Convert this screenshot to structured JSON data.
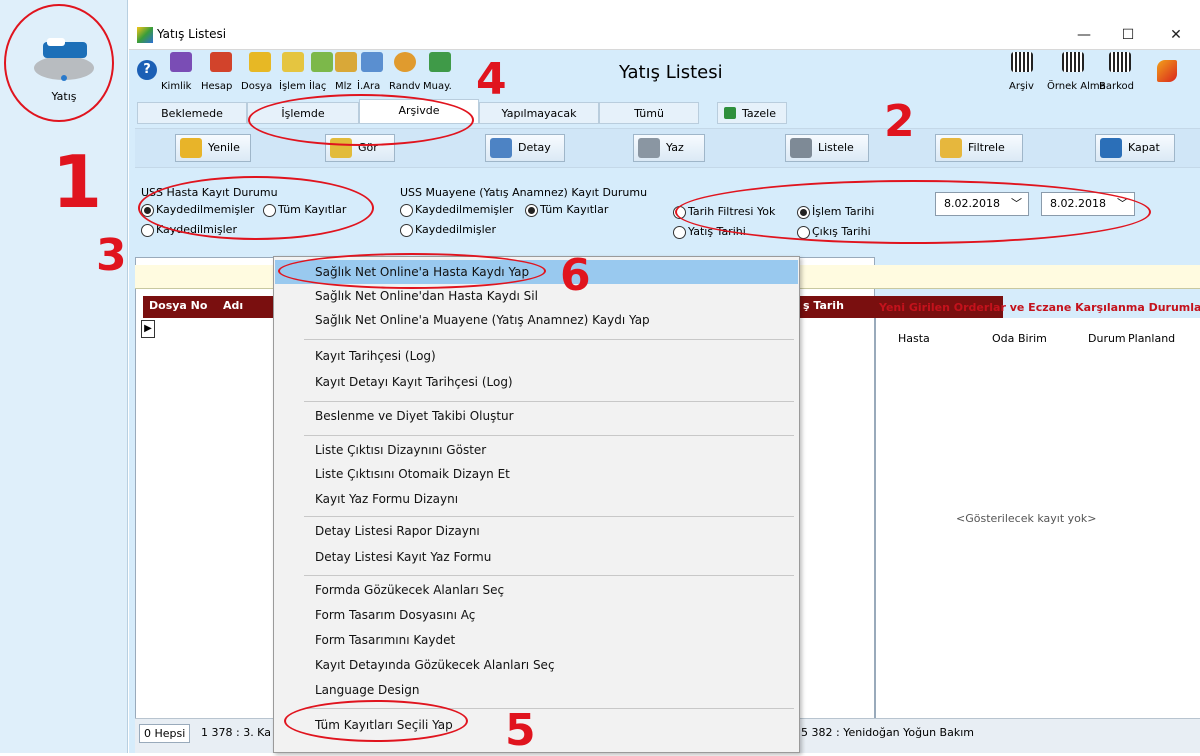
{
  "left_panel": {
    "tile_label": "Yatış"
  },
  "window": {
    "title": "Yatış Listesi",
    "min": "—",
    "max": "☐",
    "close": "✕"
  },
  "toolbar": {
    "title": "Yatış Listesi",
    "items": [
      "Kimlik",
      "Hesap",
      "Dosya",
      "İşlem",
      "İlaç",
      "Mlz",
      "İ.Ara",
      "Randv",
      "Muay."
    ],
    "right_items": [
      "Arşiv",
      "Örnek Alma",
      "Barkod"
    ]
  },
  "tabs": [
    "Beklemede",
    "İşlemde",
    "Arşivde",
    "Yapılmayacak",
    "Tümü",
    "Tazele"
  ],
  "buttons": [
    "Yenile",
    "Gör",
    "Detay",
    "Yaz",
    "Listele",
    "Filtrele",
    "Kapat"
  ],
  "filters": {
    "uss_hasta_title": "USS Hasta Kayıt Durumu",
    "uss_hasta_opts": [
      "Kaydedilmemişler",
      "Tüm Kayıtlar",
      "Kaydedilmişler"
    ],
    "uss_muayene_title": "USS Muayene (Yatış Anamnez) Kayıt Durumu",
    "uss_muayene_opts": [
      "Kaydedilmemişler",
      "Tüm Kayıtlar",
      "Kaydedilmişler"
    ],
    "date_opts": [
      "Tarih Filtresi Yok",
      "İşlem Tarihi",
      "Yatış Tarihi",
      "Çıkış Tarihi"
    ],
    "date_from": "8.02.2018",
    "date_to": "8.02.2018"
  },
  "grid": {
    "columns": [
      "Dosya No",
      "Adı",
      "ş Tarih"
    ]
  },
  "right_pane": {
    "title": "Yeni Girilen Orderlar ve Eczane Karşılanma Durumları",
    "columns": [
      "Hasta",
      "Oda",
      "Birim",
      "Durum",
      "Planland"
    ],
    "empty": "<Gösterilecek kayıt yok>"
  },
  "status": {
    "all": "0 Hepsi",
    "s1": "1 378 : 3. Ka",
    "s2": "5 382 : Yenidoğan Yoğun Bakım"
  },
  "context_menu": [
    "Sağlık Net Online'a Hasta Kaydı Yap",
    "Sağlık Net Online'dan Hasta Kaydı Sil",
    "Sağlık Net Online'a Muayene (Yatış Anamnez) Kaydı Yap",
    "Kayıt Tarihçesi (Log)",
    "Kayıt Detayı Kayıt Tarihçesi (Log)",
    "Beslenme ve Diyet Takibi Oluştur",
    "Liste Çıktısı Dizaynını Göster",
    "Liste Çıktısını Otomaik Dizayn Et",
    "Kayıt Yaz Formu Dizaynı",
    "Detay Listesi Rapor Dizaynı",
    "Detay Listesi Kayıt Yaz Formu",
    "Formda Gözükecek Alanları Seç",
    "Form Tasarım Dosyasını Aç",
    "Form Tasarımını Kaydet",
    "Kayıt Detayında Gözükecek Alanları Seç",
    "Language Design",
    "Tüm Kayıtları Seçili Yap"
  ],
  "annotations": [
    "1",
    "2",
    "3",
    "4",
    "5",
    "6"
  ],
  "colors": {
    "accent_red": "#e0141e",
    "header": "#7a0f0f",
    "selected": "#99c9ef"
  }
}
